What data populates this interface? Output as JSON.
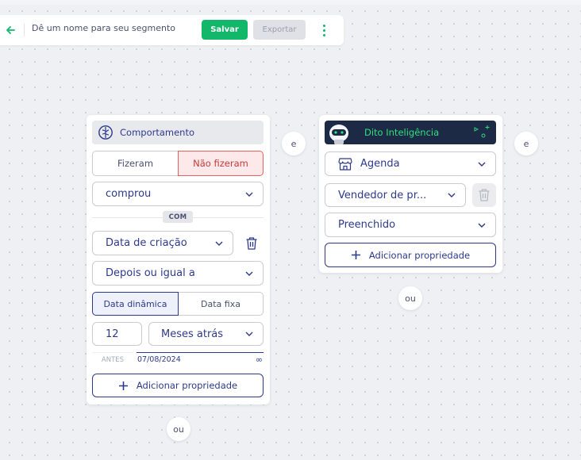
{
  "toolbar": {
    "segment_name_placeholder": "Dê um nome para seu segmento",
    "save_label": "Salvar",
    "export_label": "Exportar"
  },
  "card_comportamento": {
    "title": "Comportamento",
    "toggle_did": "Fizeram",
    "toggle_did_not": "Não fizeram",
    "event_select": "comprou",
    "with_label": "COM",
    "property_select": "Data de criação",
    "operator_select": "Depois ou igual a",
    "date_mode_dynamic": "Data dinâmica",
    "date_mode_fixed": "Data fixa",
    "amount_value": "12",
    "unit_select": "Meses atrás",
    "before_label": "ANTES",
    "date_value": "07/08/2024",
    "infinity_symbol": "∞",
    "add_property_label": "Adicionar propriedade"
  },
  "card_dito": {
    "title": "Dito Inteligência",
    "agenda_select": "Agenda",
    "property_select": "Vendedor de pr...",
    "value_select": "Preenchido",
    "add_property_label": "Adicionar propriedade"
  },
  "connectors": {
    "and_label": "e",
    "or_label": "ou"
  },
  "colors": {
    "primary": "#2d3a8c",
    "success": "#12b76a",
    "danger": "#e26161",
    "dito_header": "#1c2a46",
    "dito_accent": "#2ee07f"
  },
  "icons": [
    "arrow-left-icon",
    "kebab-menu-icon",
    "brain-icon",
    "chevron-down-icon",
    "trash-icon",
    "plus-icon",
    "store-icon",
    "robot-avatar-icon"
  ]
}
